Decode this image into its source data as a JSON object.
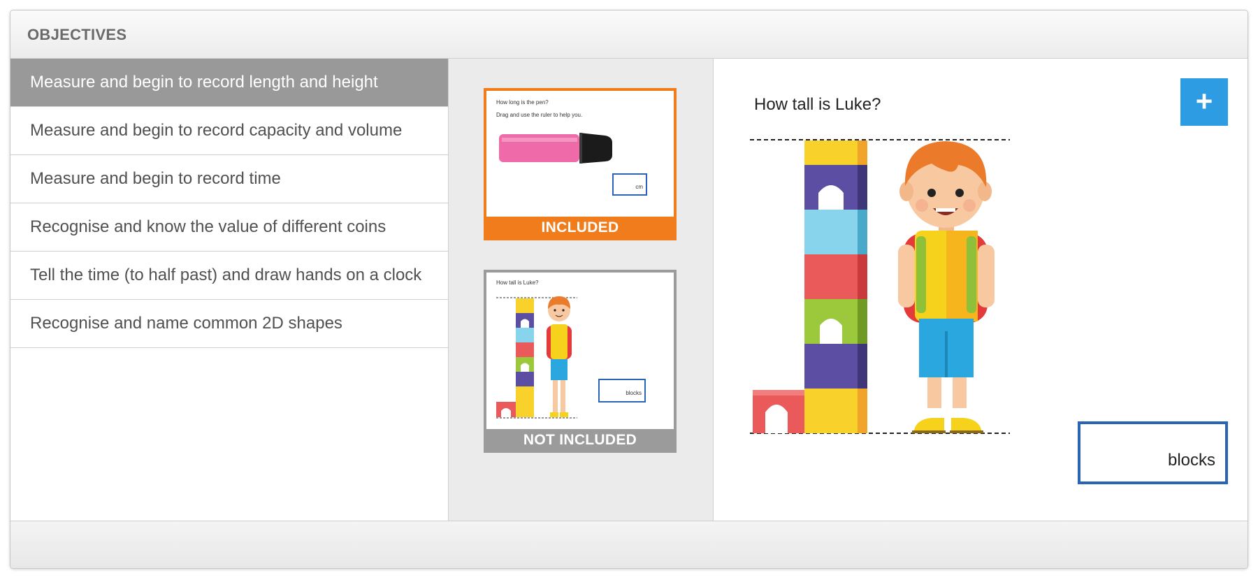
{
  "panel": {
    "title": "OBJECTIVES"
  },
  "objectives": [
    {
      "label": "Measure and begin to record length and height",
      "selected": true
    },
    {
      "label": "Measure and begin to record capacity and volume",
      "selected": false
    },
    {
      "label": "Measure and begin to record time",
      "selected": false
    },
    {
      "label": "Recognise and know the value of different coins",
      "selected": false
    },
    {
      "label": "Tell the time (to half past) and draw hands on a clock",
      "selected": false
    },
    {
      "label": "Recognise and name common 2D shapes",
      "selected": false
    }
  ],
  "thumbnails": {
    "included": {
      "label": "INCLUDED",
      "question": "How long is the pen?",
      "instruction": "Drag and use the ruler to help you.",
      "unit": "cm"
    },
    "not_included": {
      "label": "NOT INCLUDED",
      "question": "How tall is Luke?",
      "unit": "blocks"
    }
  },
  "preview": {
    "question": "How tall is Luke?",
    "answer_value": "",
    "answer_unit": "blocks",
    "expand_icon": "plus-icon",
    "expand_symbol": "+"
  },
  "colors": {
    "selected_item_bg": "#999999",
    "included_accent": "#f07c1c",
    "not_included_accent": "#9b9b9b",
    "expand_button": "#2e9ce3",
    "answer_box_border": "#2a64b6"
  }
}
